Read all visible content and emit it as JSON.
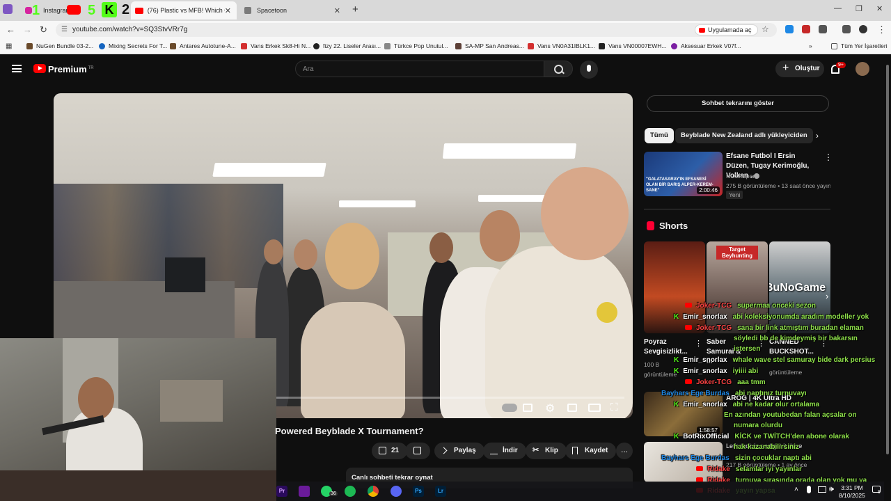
{
  "browser": {
    "tabs": [
      {
        "label": "Instagram",
        "active": false
      },
      {
        "label": "(76) Plastic vs MFB! Which Gen",
        "active": true
      },
      {
        "label": "Spacetoon",
        "active": false
      }
    ],
    "new_tab": "+",
    "overlay_digits": {
      "a": "1",
      "b": "5",
      "c": "2"
    },
    "url": "youtube.com/watch?v=SQ3StvVRr7g",
    "open_in_app": "Uygulamada aç",
    "bookmarks": [
      {
        "label": "NuGen Bundle 03-2...",
        "color": "#6a4a2a"
      },
      {
        "label": "Mixing Secrets For T...",
        "color": "#1565c0"
      },
      {
        "label": "Antares Autotune-A...",
        "color": "#6a4a2a"
      },
      {
        "label": "Vans Erkek Sk8-Hi N...",
        "color": "#d32f2f"
      },
      {
        "label": "fizy 22. Liseler Arası...",
        "color": "#222222"
      },
      {
        "label": "Türkce Pop Unutul...",
        "color": "#888888"
      },
      {
        "label": "SA-MP San Andreas...",
        "color": "#5d4037"
      },
      {
        "label": "Vans VN0A31IBLK1...",
        "color": "#d32f2f"
      },
      {
        "label": "Vans VN00007EWH...",
        "color": "#222222"
      },
      {
        "label": "Aksesuar Erkek V07f...",
        "color": "#7b1fa2"
      }
    ],
    "all_bookmarks": "Tüm Yer İşaretleri"
  },
  "youtube": {
    "brand": "Premium",
    "brand_sup": "TR",
    "search_placeholder": "Ara",
    "create": "Oluştur",
    "notif_count": "9+",
    "video_title": "Powered Beyblade X Tournament?",
    "likes": "21",
    "share": "Paylaş",
    "download": "İndir",
    "clip": "Klip",
    "save": "Kaydet",
    "more": "...",
    "chat_replay": "Canlı sohbeti tekrar oynat"
  },
  "sidebar": {
    "show_chat": "Sohbet tekrarını göster",
    "chips": [
      "Tümü",
      "Beyblade New Zealand adlı yükleyiciden"
    ],
    "rec": {
      "title": "Efsane Futbol I Ersin Düzen, Tugay Kerimoğlu, Volkan ...",
      "channel": "NOW Spor",
      "meta": "275 B görüntüleme • 13 saat önce yayınl...",
      "badge": "Yeni",
      "duration": "2:00:46",
      "thumb_text": "\"GALATASARAY'IN EFSANESİ OLAN BİR BARIŞ ALPER-KEREM-SANE\""
    },
    "shorts_title": "Shorts",
    "shorts": [
      {
        "title": "Poyraz Sevgisizlikt...",
        "views": "100 B görüntüleme"
      },
      {
        "title": "Saber Samurai & ...",
        "views": "",
        "overlay": "Target Beyhunting"
      },
      {
        "title": "CANNED BUCKSHOT...",
        "views": "görüntüleme",
        "overlay": "BuNoGame"
      }
    ],
    "rec2": {
      "title": "AROG | 4K Ultra HD",
      "duration": "1:58:57"
    },
    "rec3": {
      "title": "Let's look in and get it done",
      "meta": "217 B görüntüleme • 1 ay önce"
    }
  },
  "chat": [
    {
      "src": "yt",
      "user": "Joker-TCG",
      "msg": "supermaa onceki sezon"
    },
    {
      "src": "kick",
      "user": "Emir_snorlax",
      "msg": "abi koleksiyonumda aradım modeller yok"
    },
    {
      "src": "yt",
      "user": "Joker-TCG",
      "msg": "sana bir link atmıştım buradan elaman"
    },
    {
      "src": "",
      "user": "",
      "msg": "söyledi bb de kimdeymiş bir bakarsın"
    },
    {
      "src": "",
      "user": "",
      "msg": "istersen"
    },
    {
      "src": "kick",
      "user": "Emir_snorlax",
      "msg": "whale wave stel samuray bide dark persius"
    },
    {
      "src": "kick",
      "user": "Emir_snorlax",
      "msg": "iyiiii abi"
    },
    {
      "src": "yt",
      "user": "Joker-TCG",
      "msg": "aaa tmm"
    },
    {
      "src": "",
      "user": "Bayhars Ege Burdas",
      "msg": "abi naptınız turnuvayı"
    },
    {
      "src": "kick",
      "user": "Emir_snorlax",
      "msg": "abi ne kadar olur ortalama"
    },
    {
      "src": "",
      "user": "",
      "msg": "En azından youtubedan falan açsalar on"
    },
    {
      "src": "",
      "user": "",
      "msg": "numara olurdu"
    },
    {
      "src": "kick",
      "user": "BotRixOfficial",
      "msg": "KİCK ve TWİTCH'den abone olarak"
    },
    {
      "src": "",
      "user": "",
      "msg": "hak kazanabilirsiniz"
    },
    {
      "src": "",
      "user": "Bayhars Ege Burdas",
      "msg": "sizin çocuklar naptı abi"
    },
    {
      "src": "yt",
      "user": "Ridake",
      "msg": "selamlar iyi yayınlar"
    },
    {
      "src": "yt",
      "user": "Ridake",
      "msg": "turnuva sırasında orada olan yok mu ya"
    },
    {
      "src": "yt",
      "user": "Ridake",
      "msg": "yayın yapsa"
    }
  ],
  "taskbar": {
    "apps": [
      "Pr",
      "Ps",
      "Lr"
    ],
    "whatsapp_count": "36",
    "time": "3:31 PM",
    "date": "8/10/2025",
    "notif": "9"
  },
  "colors": {
    "yt_red": "#ff0000",
    "kick_green": "#53fc18",
    "chat_msg": "#8ee04a"
  }
}
